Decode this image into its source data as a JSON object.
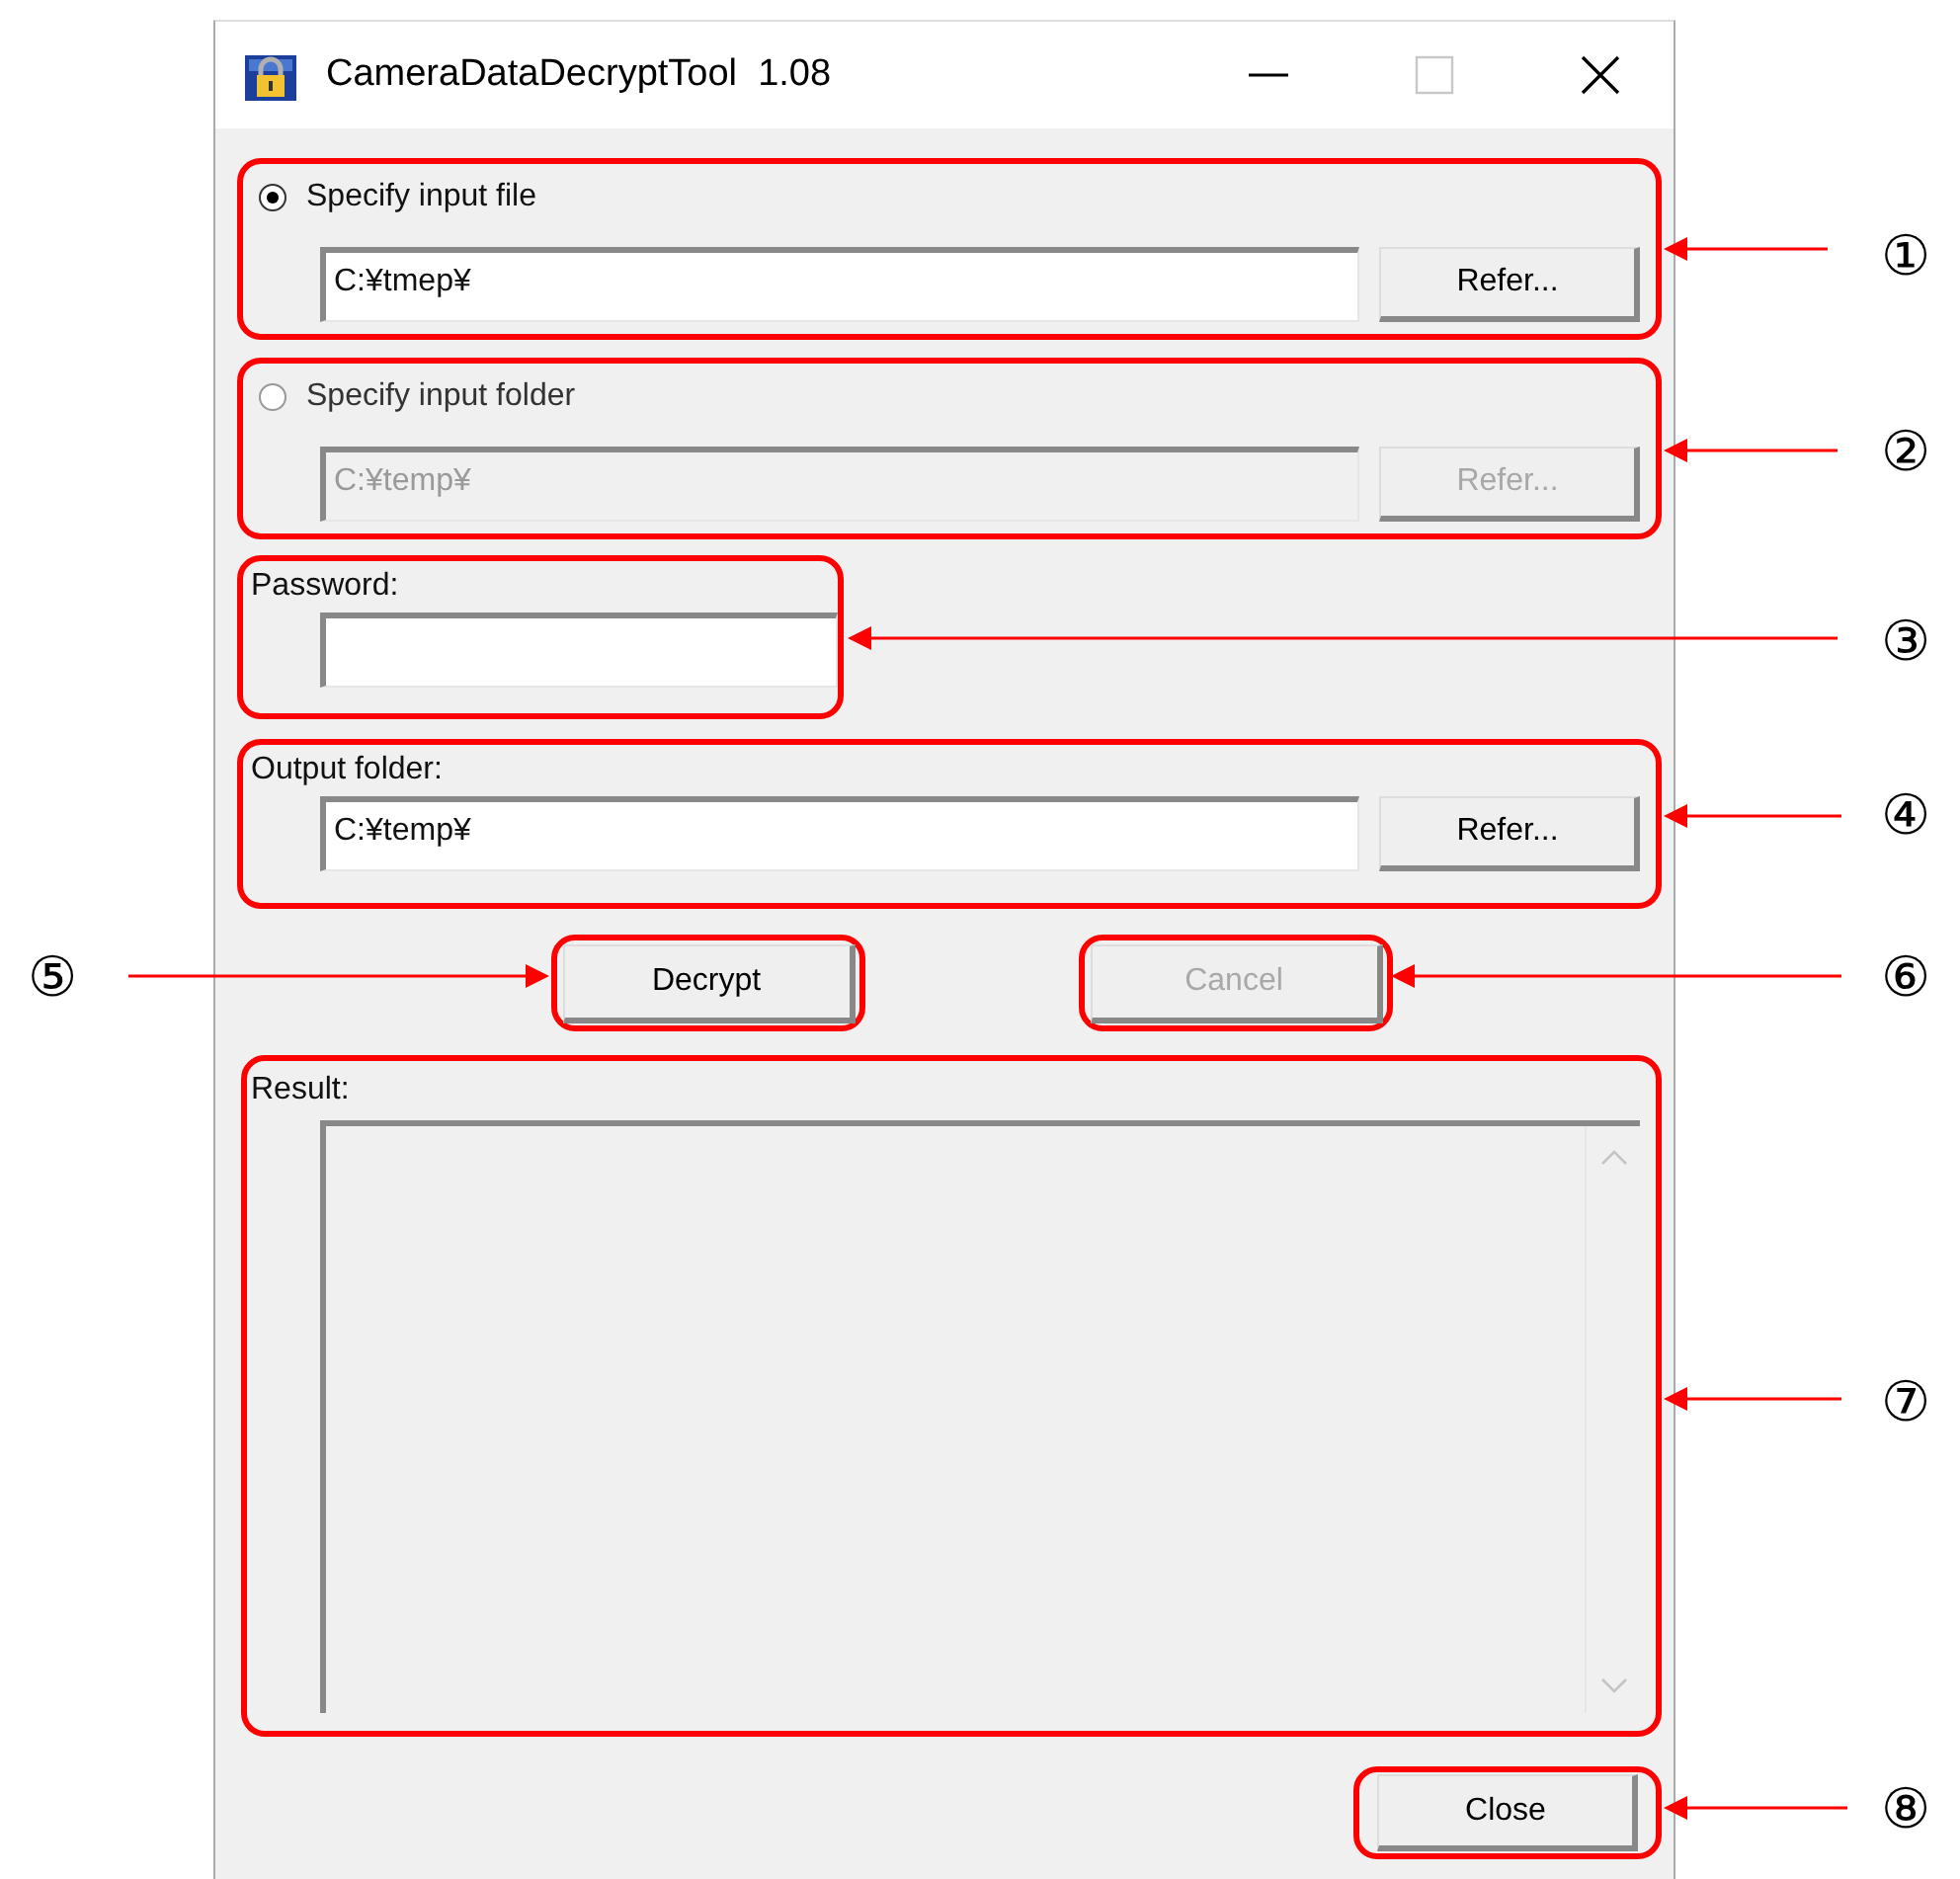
{
  "window": {
    "title": "CameraDataDecryptTool  1.08"
  },
  "inputs": [
    {
      "label": "Specify input file",
      "selected": true,
      "disabled": false,
      "path": "C:¥tmep¥",
      "button": "Refer..."
    },
    {
      "label": "Specify input folder",
      "selected": false,
      "disabled": true,
      "path": "C:¥temp¥",
      "button": "Refer..."
    }
  ],
  "password": {
    "label": "Password:"
  },
  "output": {
    "label": "Output folder:",
    "path": "C:¥temp¥",
    "button": "Refer..."
  },
  "actions": [
    {
      "label": "Decrypt",
      "disabled": false
    },
    {
      "label": "Cancel",
      "disabled": true
    }
  ],
  "result": {
    "label": "Result:"
  },
  "close": {
    "label": "Close"
  },
  "callouts": [
    "①",
    "②",
    "③",
    "④",
    "⑤",
    "⑥",
    "⑦",
    "⑧"
  ]
}
